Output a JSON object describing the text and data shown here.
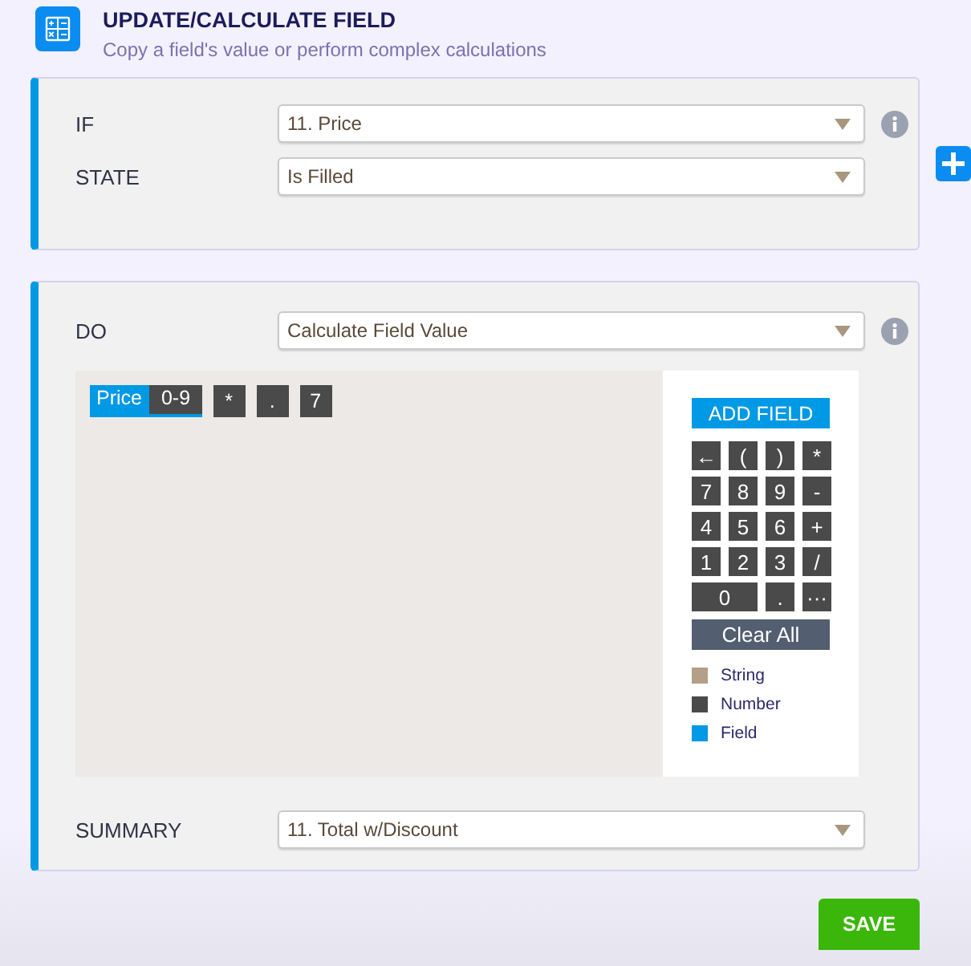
{
  "header": {
    "title": "UPDATE/CALCULATE FIELD",
    "subtitle": "Copy a field's value or perform complex calculations"
  },
  "condition": {
    "rows": [
      {
        "label": "IF",
        "value": "11. Price",
        "info": true
      },
      {
        "label": "STATE",
        "value": "Is Filled",
        "info": false
      }
    ]
  },
  "action": {
    "label": "DO",
    "value": "Calculate Field Value",
    "info": true,
    "formula": [
      {
        "kind": "field",
        "label": "Price",
        "type_label": "0-9"
      },
      {
        "kind": "number",
        "label": "*"
      },
      {
        "kind": "number",
        "label": "."
      },
      {
        "kind": "number",
        "label": "7"
      }
    ],
    "add_field": "ADD FIELD",
    "keys": [
      {
        "label": "←",
        "wide": false
      },
      {
        "label": "(",
        "wide": false
      },
      {
        "label": ")",
        "wide": false
      },
      {
        "label": "*",
        "wide": false
      },
      {
        "label": "7",
        "wide": false
      },
      {
        "label": "8",
        "wide": false
      },
      {
        "label": "9",
        "wide": false
      },
      {
        "label": "-",
        "wide": false
      },
      {
        "label": "4",
        "wide": false
      },
      {
        "label": "5",
        "wide": false
      },
      {
        "label": "6",
        "wide": false
      },
      {
        "label": "+",
        "wide": false
      },
      {
        "label": "1",
        "wide": false
      },
      {
        "label": "2",
        "wide": false
      },
      {
        "label": "3",
        "wide": false
      },
      {
        "label": "/",
        "wide": false
      },
      {
        "label": "0",
        "wide": true
      },
      {
        "label": ".",
        "wide": false
      },
      {
        "label": "···",
        "wide": false
      }
    ],
    "clear_all": "Clear All",
    "legend": [
      {
        "label": "String",
        "color": "#b49f87"
      },
      {
        "label": "Number",
        "color": "#4a4a4a"
      },
      {
        "label": "Field",
        "color": "#0099e5"
      }
    ],
    "summary": {
      "label": "SUMMARY",
      "value": "11. Total w/Discount"
    }
  },
  "save": "SAVE"
}
